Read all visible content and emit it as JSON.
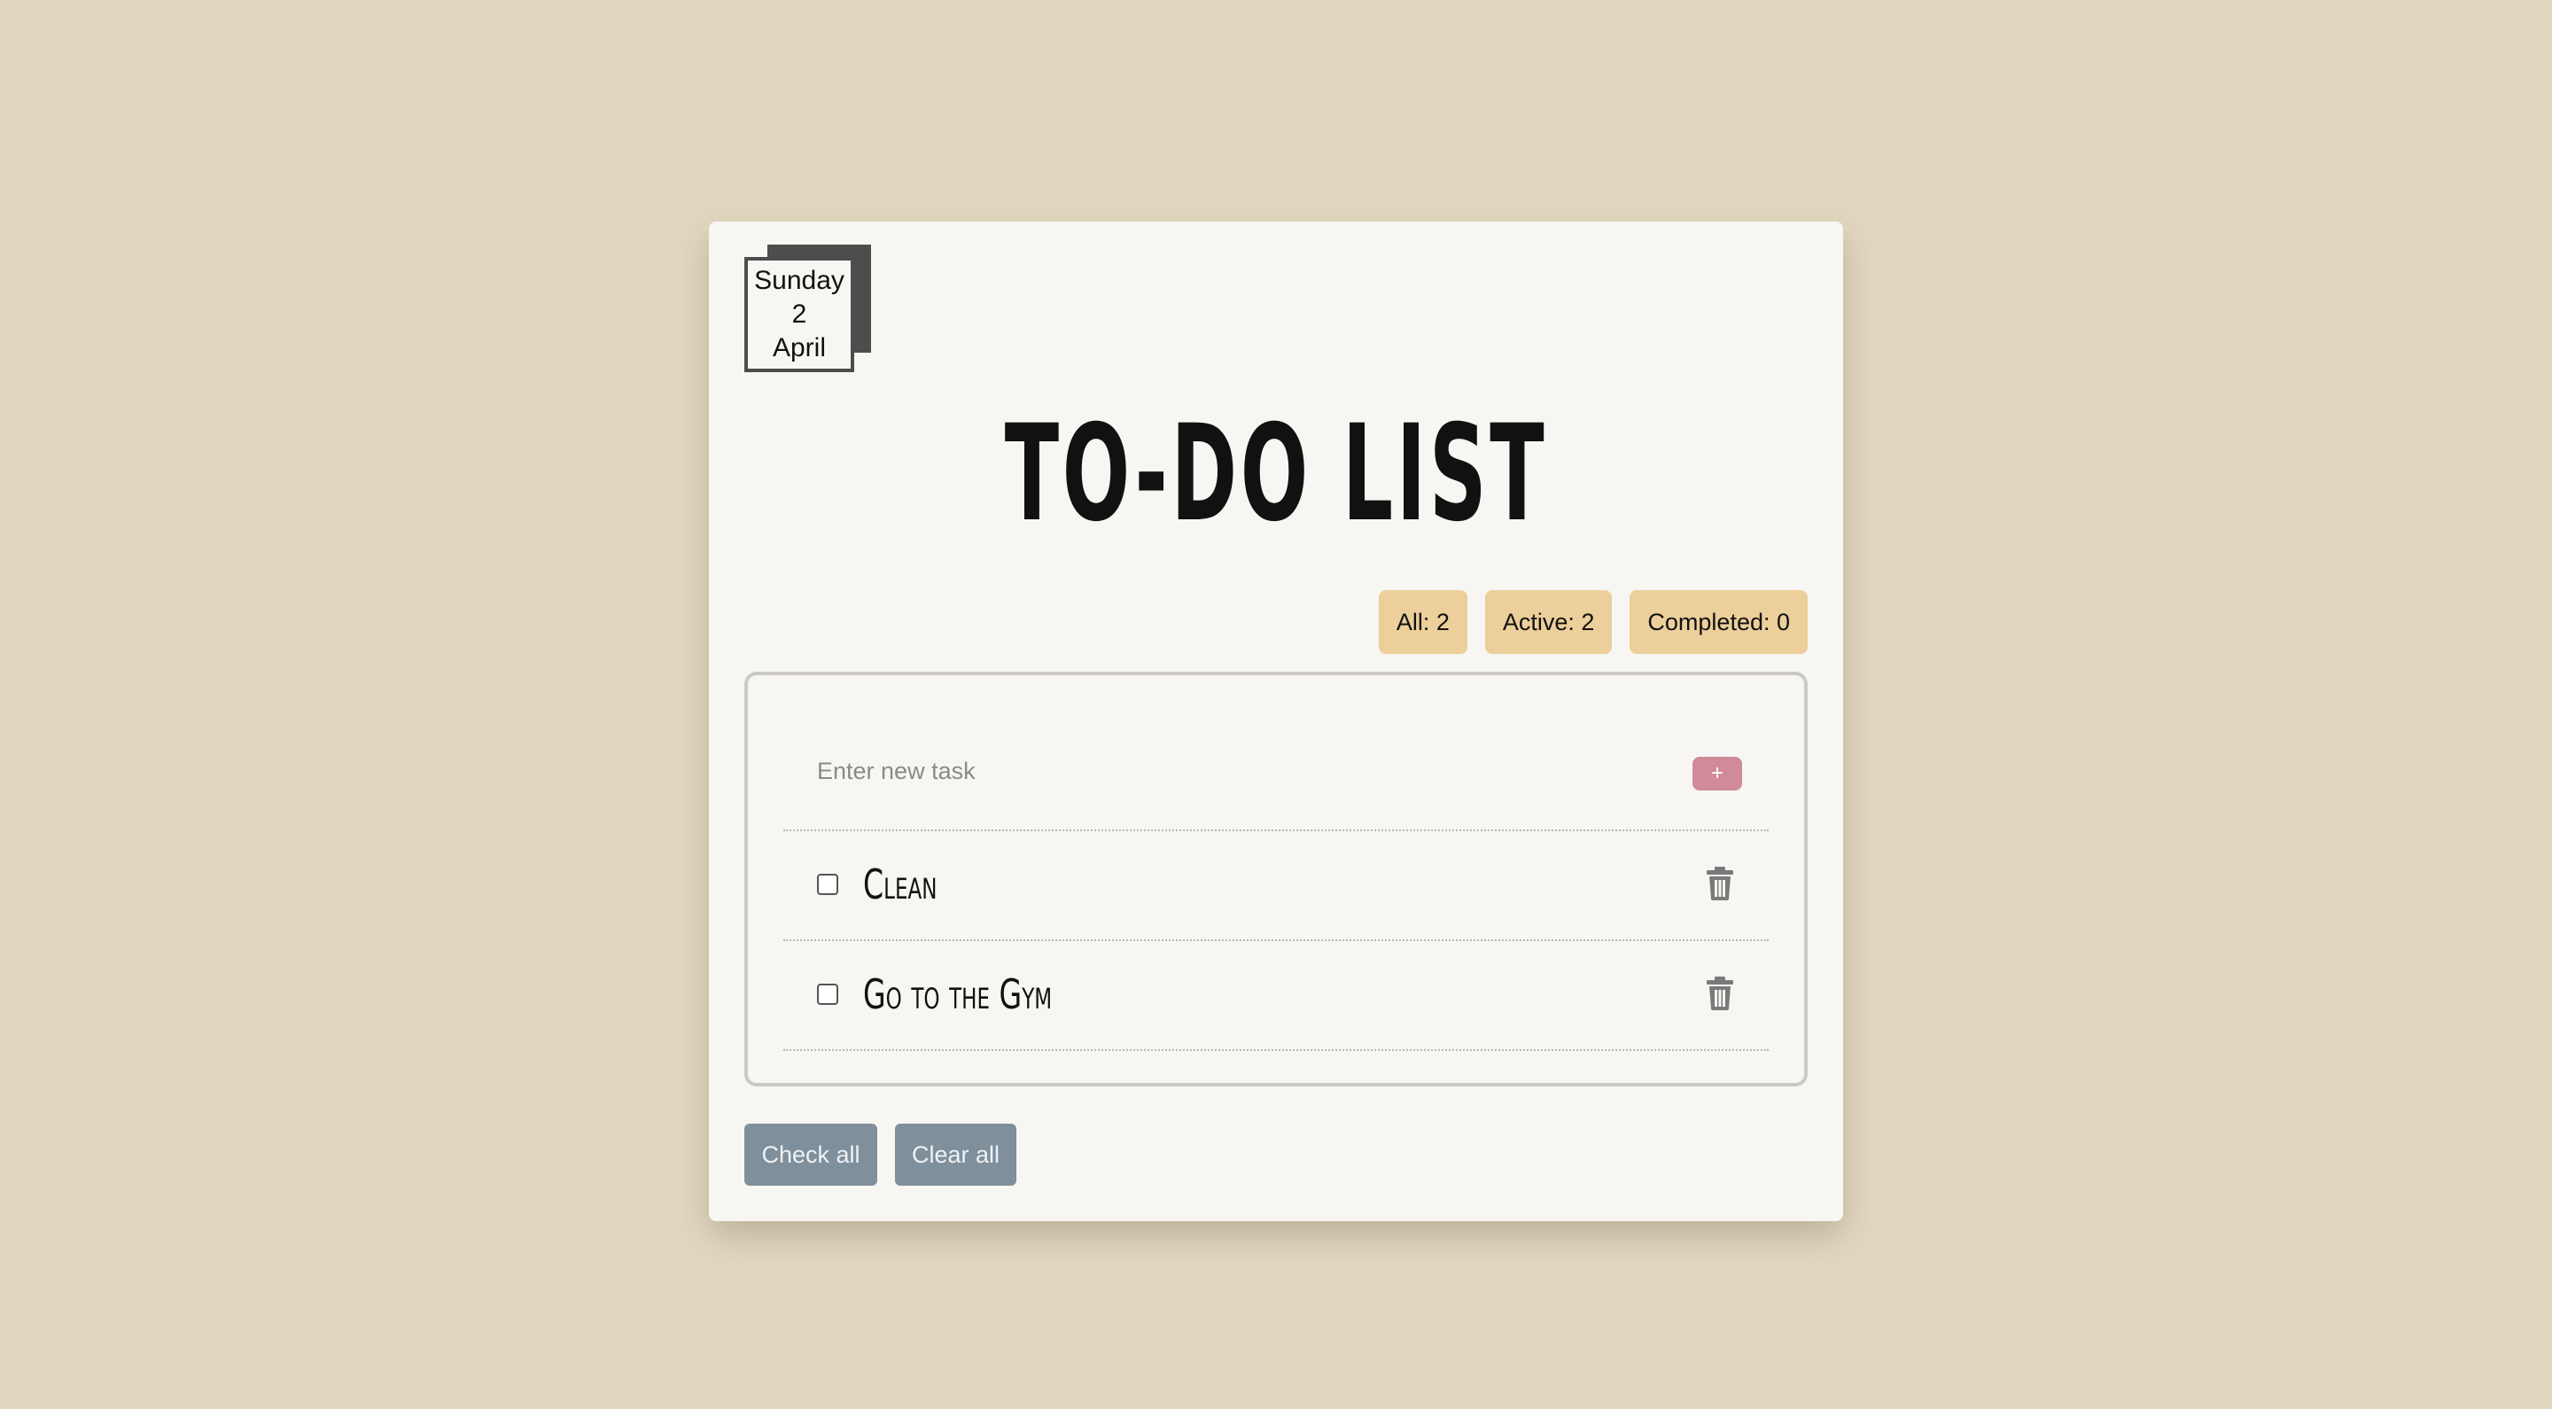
{
  "date": {
    "weekday": "Sunday",
    "day": "2",
    "month": "April"
  },
  "title": "TO-DO LIST",
  "counters": {
    "all": "All: 2",
    "active": "Active: 2",
    "completed": "Completed: 0"
  },
  "new_task": {
    "placeholder": "Enter new task",
    "add_label": "+"
  },
  "tasks": [
    {
      "text": "Clean",
      "checked": false
    },
    {
      "text": "Go to the Gym",
      "checked": false
    }
  ],
  "actions": {
    "check_all": "Check all",
    "clear_all": "Clear all"
  },
  "colors": {
    "background": "#e2d8c0",
    "card": "#f7f6f2",
    "counter": "#eccf9a",
    "add_button": "#d08a98",
    "action_button": "#7f8f9b"
  },
  "icons": {
    "delete": "trash-icon"
  }
}
